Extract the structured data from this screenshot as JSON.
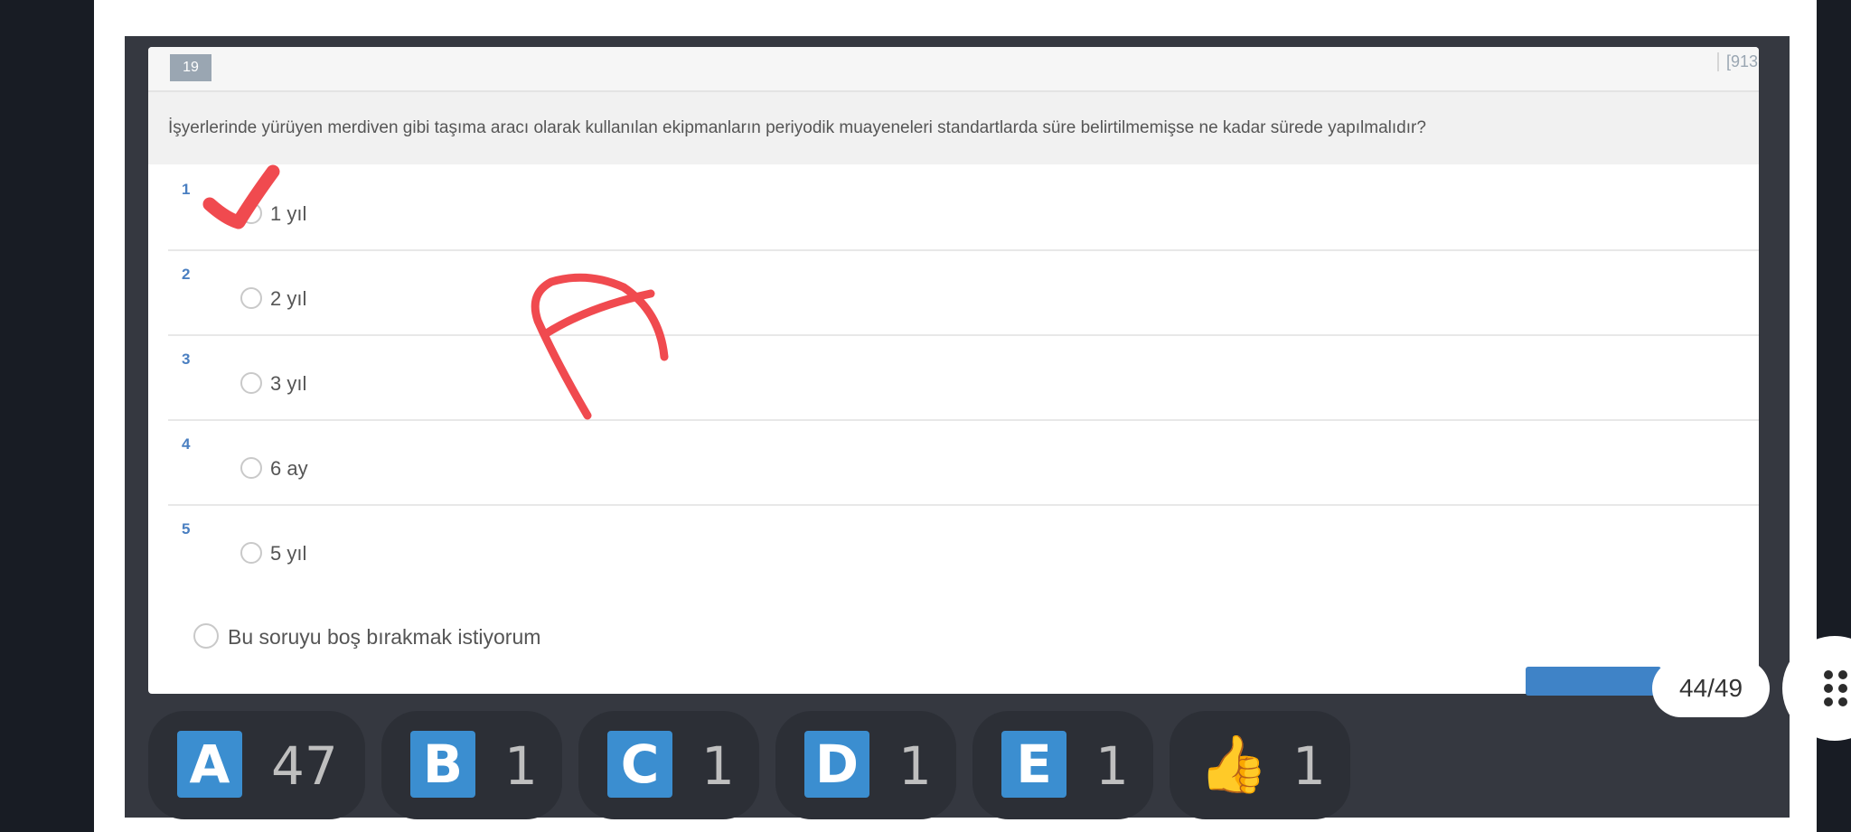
{
  "question": {
    "number": "19",
    "id_partial": "[913",
    "text": "İşyerlerinde yürüyen merdiven gibi taşıma aracı olarak kullanılan ekipmanların periyodik muayeneleri standartlarda süre belirtilmemişse ne kadar sürede yapılmalıdır?"
  },
  "options": [
    {
      "num": "1",
      "label": "1 yıl",
      "marked": true
    },
    {
      "num": "2",
      "label": "2 yıl"
    },
    {
      "num": "3",
      "label": "3 yıl"
    },
    {
      "num": "4",
      "label": "6 ay"
    },
    {
      "num": "5",
      "label": "5 yıl"
    }
  ],
  "skip_label": "Bu soruyu boş bırakmak istiyorum",
  "reactions": [
    {
      "letter": "A",
      "count": "47"
    },
    {
      "letter": "B",
      "count": "1"
    },
    {
      "letter": "C",
      "count": "1"
    },
    {
      "letter": "D",
      "count": "1"
    },
    {
      "letter": "E",
      "count": "1"
    },
    {
      "emoji": "👍",
      "icon": "thumbs-up-icon",
      "count": "1"
    }
  ],
  "page_counter": "44/49",
  "handwritten_annotation": "A",
  "colors": {
    "accent_blue": "#3b8ed0",
    "annotation_red": "#f04a4f",
    "background_dark": "#181c24"
  }
}
